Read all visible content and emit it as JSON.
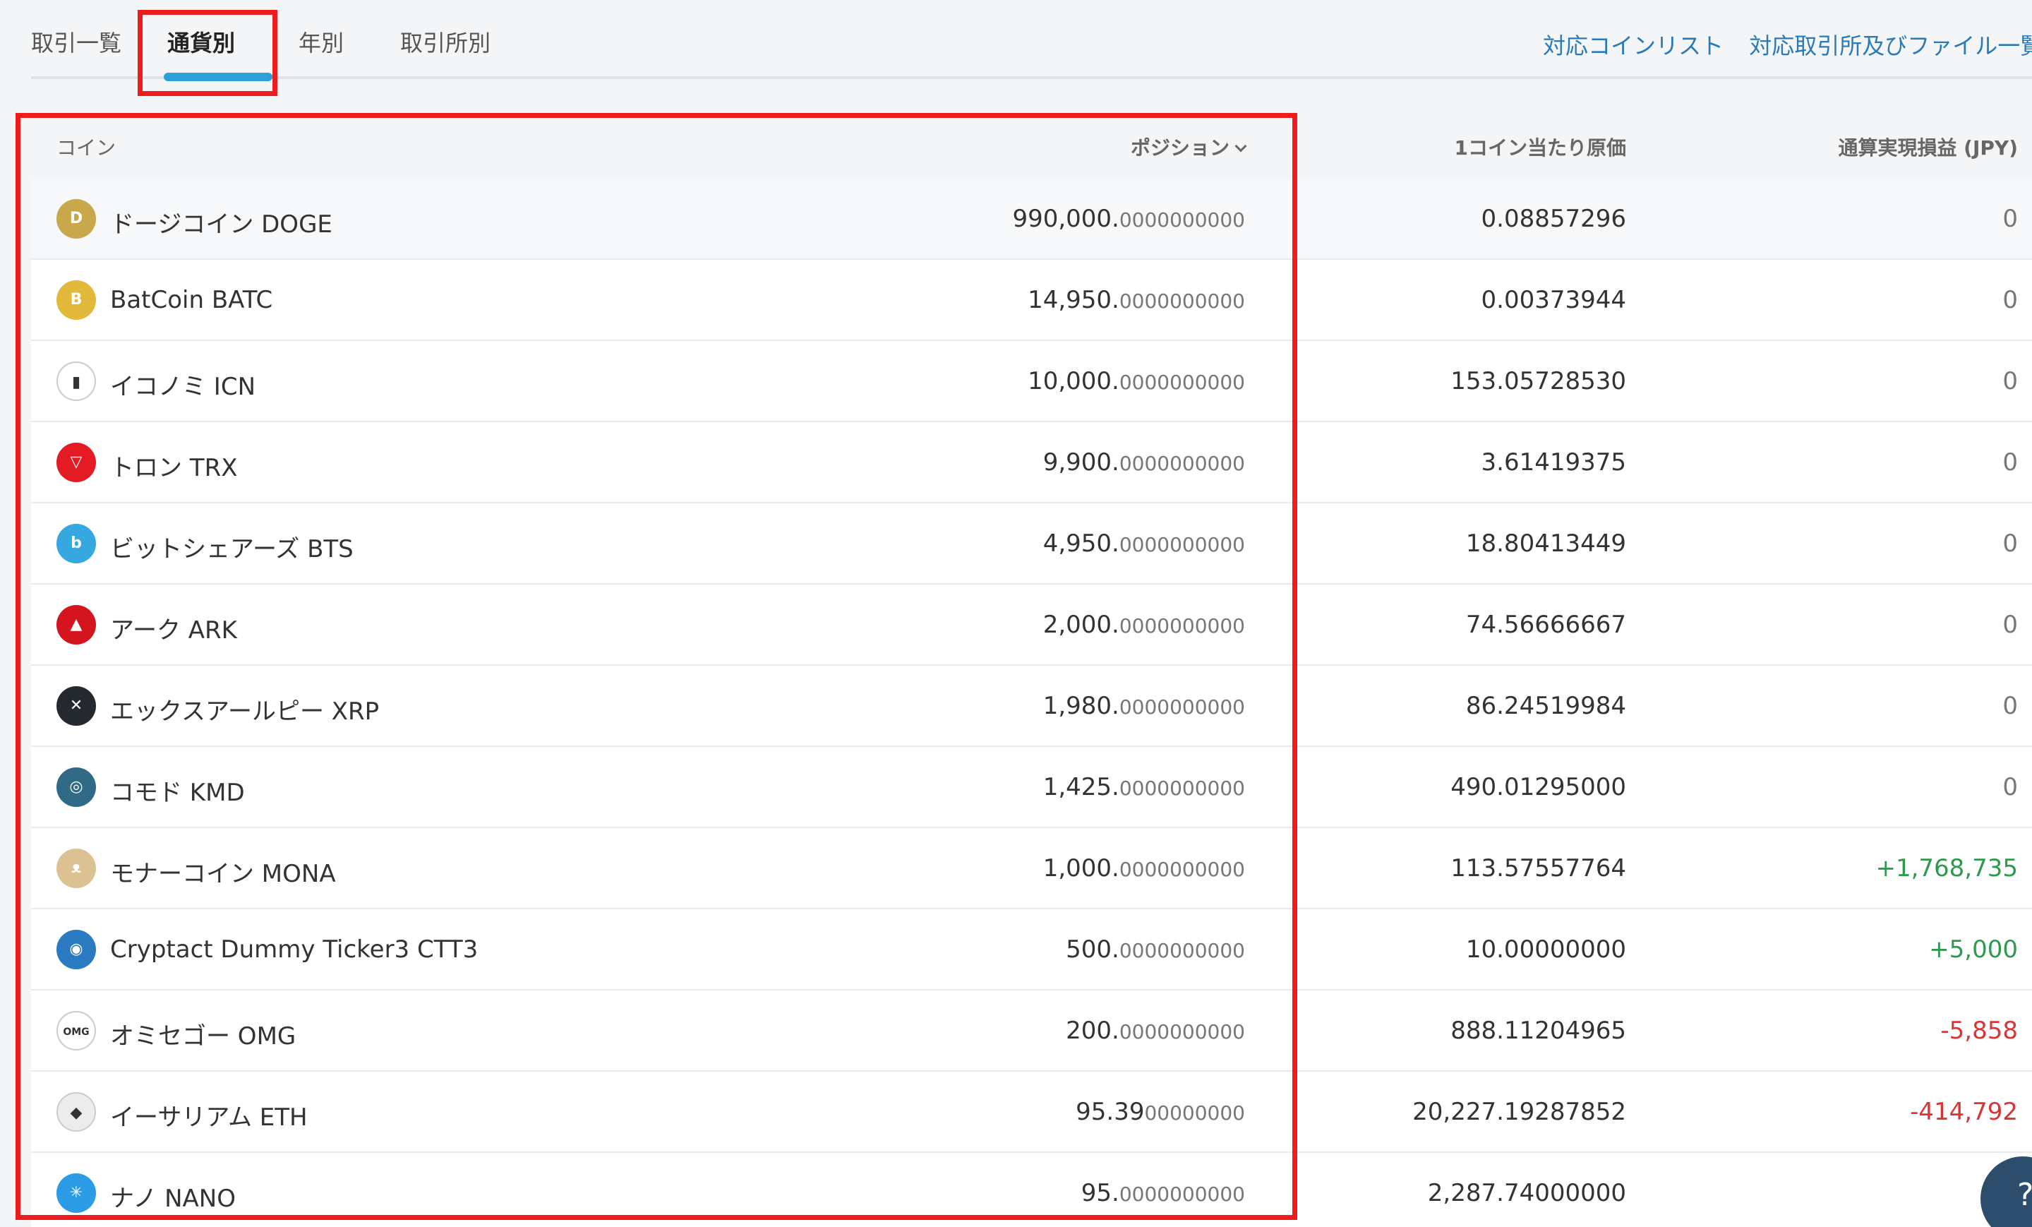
{
  "tabs": [
    {
      "label": "取引一覧",
      "active": false
    },
    {
      "label": "通貨別",
      "active": true
    },
    {
      "label": "年別",
      "active": false
    },
    {
      "label": "取引所別",
      "active": false
    }
  ],
  "links": {
    "coin_list": "対応コインリスト",
    "exchange_list": "対応取引所及びファイル一覧"
  },
  "table": {
    "headers": {
      "coin": "コイン",
      "position": "ポジション",
      "cost_per_coin": "1コイン当たり原価",
      "realized_pnl": "通算実現損益 (JPY)"
    },
    "rows": [
      {
        "name": "ドージコイン DOGE",
        "pos_int": "990,000.",
        "pos_dec": "0000000000",
        "cost": "0.08857296",
        "pnl": "0",
        "icon": "doge-icon",
        "icon_color": "#c8a84b",
        "glyph": "D"
      },
      {
        "name": "BatCoin BATC",
        "pos_int": "14,950.",
        "pos_dec": "0000000000",
        "cost": "0.00373944",
        "pnl": "0",
        "icon": "batc-icon",
        "icon_color": "#e2b93b",
        "glyph": "B"
      },
      {
        "name": "イコノミ ICN",
        "pos_int": "10,000.",
        "pos_dec": "0000000000",
        "cost": "153.05728530",
        "pnl": "0",
        "icon": "icn-icon",
        "icon_color": "#ffffff",
        "glyph": "▮"
      },
      {
        "name": "トロン TRX",
        "pos_int": "9,900.",
        "pos_dec": "0000000000",
        "cost": "3.61419375",
        "pnl": "0",
        "icon": "trx-icon",
        "icon_color": "#e51b23",
        "glyph": "▽"
      },
      {
        "name": "ビットシェアーズ BTS",
        "pos_int": "4,950.",
        "pos_dec": "0000000000",
        "cost": "18.80413449",
        "pnl": "0",
        "icon": "bts-icon",
        "icon_color": "#35a8e0",
        "glyph": "b"
      },
      {
        "name": "アーク ARK",
        "pos_int": "2,000.",
        "pos_dec": "0000000000",
        "cost": "74.56666667",
        "pnl": "0",
        "icon": "ark-icon",
        "icon_color": "#d5151e",
        "glyph": "▲"
      },
      {
        "name": "エックスアールピー XRP",
        "pos_int": "1,980.",
        "pos_dec": "0000000000",
        "cost": "86.24519984",
        "pnl": "0",
        "icon": "xrp-icon",
        "icon_color": "#23292f",
        "glyph": "✕"
      },
      {
        "name": "コモド KMD",
        "pos_int": "1,425.",
        "pos_dec": "0000000000",
        "cost": "490.01295000",
        "pnl": "0",
        "icon": "kmd-icon",
        "icon_color": "#316a86",
        "glyph": "◎"
      },
      {
        "name": "モナーコイン MONA",
        "pos_int": "1,000.",
        "pos_dec": "0000000000",
        "cost": "113.57557764",
        "pnl": "+1,768,735",
        "icon": "mona-icon",
        "icon_color": "#dcc193",
        "glyph": "ᴥ"
      },
      {
        "name": "Cryptact Dummy Ticker3 CTT3",
        "pos_int": "500.",
        "pos_dec": "0000000000",
        "cost": "10.00000000",
        "pnl": "+5,000",
        "icon": "ctt3-icon",
        "icon_color": "#2b7bc3",
        "glyph": "◉"
      },
      {
        "name": "オミセゴー OMG",
        "pos_int": "200.",
        "pos_dec": "0000000000",
        "cost": "888.11204965",
        "pnl": "-5,858",
        "icon": "omg-icon",
        "icon_color": "#ffffff",
        "glyph": "OMG"
      },
      {
        "name": "イーサリアム ETH",
        "pos_int": "95.39",
        "pos_dec": "00000000",
        "cost": "20,227.19287852",
        "pnl": "-414,792",
        "icon": "eth-icon",
        "icon_color": "#ececec",
        "glyph": "◆"
      },
      {
        "name": "ナノ NANO",
        "pos_int": "95.",
        "pos_dec": "0000000000",
        "cost": "2,287.74000000",
        "pnl": "",
        "icon": "nano-icon",
        "icon_color": "#2b9be5",
        "glyph": "✳"
      }
    ]
  },
  "help": {
    "glyph": "?"
  }
}
